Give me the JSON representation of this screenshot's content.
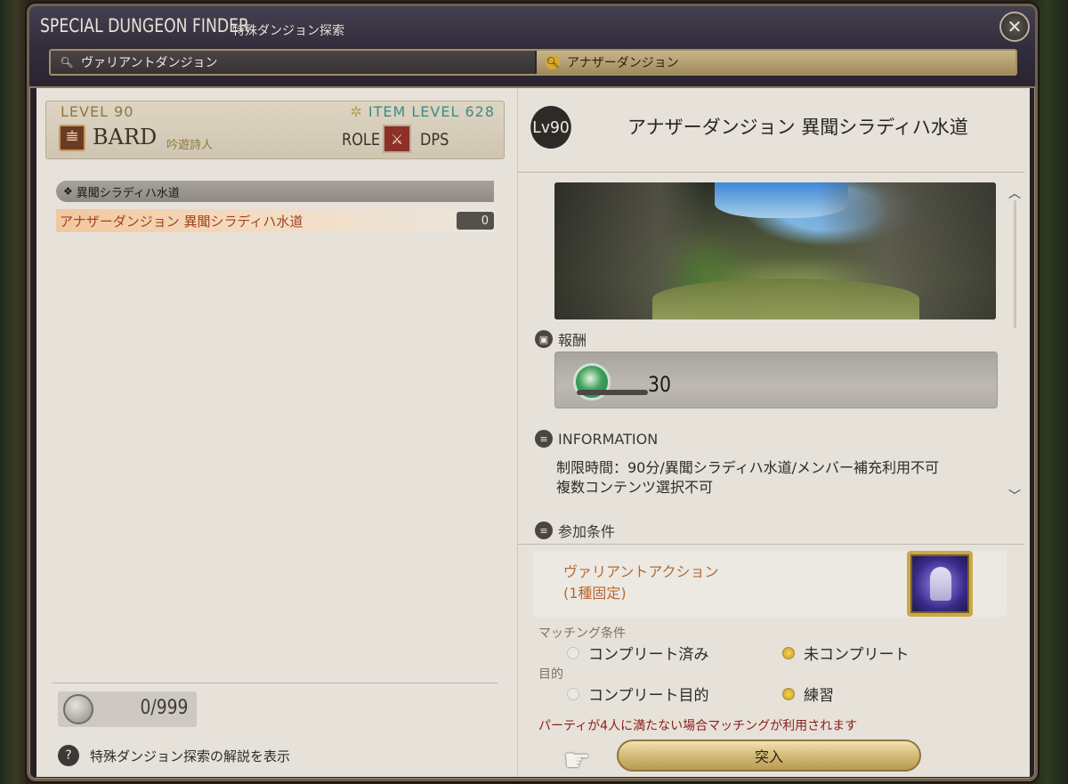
{
  "window": {
    "title_en": "SPECIAL DUNGEON FINDER",
    "title_jp": "特殊ダンジョン探索"
  },
  "tabs": [
    {
      "label": "ヴァリアントダンジョン",
      "selected": false,
      "icon": "search-icon"
    },
    {
      "label": "アナザーダンジョン",
      "selected": true,
      "icon": "search-icon"
    }
  ],
  "character": {
    "level": "LEVEL 90",
    "item_level": "ITEM LEVEL 628",
    "job": "BARD",
    "job_jp": "吟遊詩人",
    "role_label": "ROLE",
    "role": "DPS"
  },
  "duty_list": {
    "category": "異聞シラディハ水道",
    "items": [
      {
        "name": "アナザーダンジョン 異聞シラディハ水道",
        "count": "0"
      }
    ]
  },
  "tokens": {
    "value": "0/999"
  },
  "help": {
    "label": "特殊ダンジョン探索の解説を表示"
  },
  "detail": {
    "level_badge": "Lv90",
    "title": "アナザーダンジョン 異聞シラディハ水道",
    "reward_header": "報酬",
    "reward_value": "30",
    "info_header": "INFORMATION",
    "info_line1": "制限時間：90分/異聞シラディハ水道/メンバー補充利用不可",
    "info_line2": "複数コンテンツ選択不可",
    "req_header": "参加条件",
    "req_line1": "ヴァリアントアクション",
    "req_line2": "(1種固定)",
    "matching_label": "マッチング条件",
    "matching_options": [
      "コンプリート済み",
      "未コンプリート"
    ],
    "matching_selected": 1,
    "purpose_label": "目的",
    "purpose_options": [
      "コンプリート目的",
      "練習"
    ],
    "purpose_selected": 1,
    "notice": "パーティが4人に満たない場合マッチングが利用されます",
    "enter_label": "突入"
  },
  "colors": {
    "accent_gold": "#c9a84e",
    "duty_selected": "#a3431a",
    "notice_red": "#8c1c18",
    "item_level_teal": "#3c8c86"
  }
}
